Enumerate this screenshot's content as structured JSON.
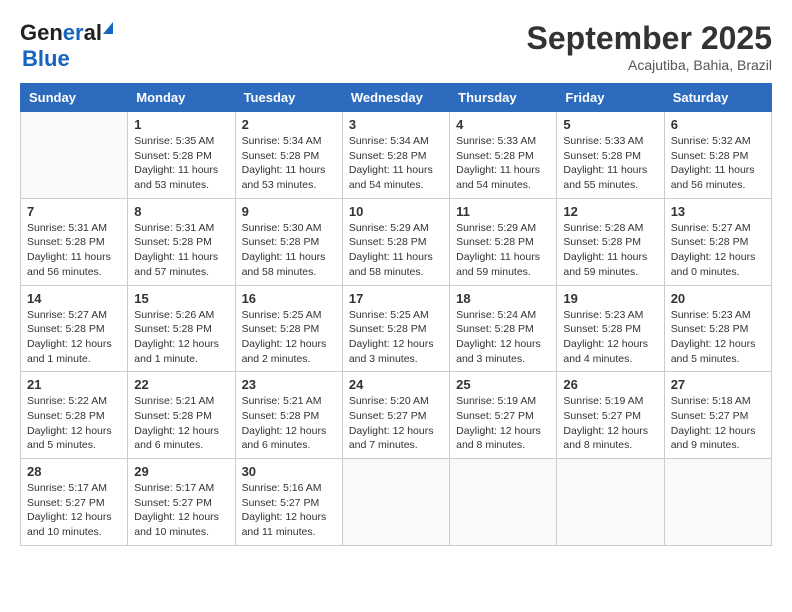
{
  "header": {
    "logo_line1": "General",
    "logo_line2": "Blue",
    "month": "September 2025",
    "location": "Acajutiba, Bahia, Brazil"
  },
  "weekdays": [
    "Sunday",
    "Monday",
    "Tuesday",
    "Wednesday",
    "Thursday",
    "Friday",
    "Saturday"
  ],
  "weeks": [
    [
      {
        "day": "",
        "sunrise": "",
        "sunset": "",
        "daylight": ""
      },
      {
        "day": "1",
        "sunrise": "Sunrise: 5:35 AM",
        "sunset": "Sunset: 5:28 PM",
        "daylight": "Daylight: 11 hours and 53 minutes."
      },
      {
        "day": "2",
        "sunrise": "Sunrise: 5:34 AM",
        "sunset": "Sunset: 5:28 PM",
        "daylight": "Daylight: 11 hours and 53 minutes."
      },
      {
        "day": "3",
        "sunrise": "Sunrise: 5:34 AM",
        "sunset": "Sunset: 5:28 PM",
        "daylight": "Daylight: 11 hours and 54 minutes."
      },
      {
        "day": "4",
        "sunrise": "Sunrise: 5:33 AM",
        "sunset": "Sunset: 5:28 PM",
        "daylight": "Daylight: 11 hours and 54 minutes."
      },
      {
        "day": "5",
        "sunrise": "Sunrise: 5:33 AM",
        "sunset": "Sunset: 5:28 PM",
        "daylight": "Daylight: 11 hours and 55 minutes."
      },
      {
        "day": "6",
        "sunrise": "Sunrise: 5:32 AM",
        "sunset": "Sunset: 5:28 PM",
        "daylight": "Daylight: 11 hours and 56 minutes."
      }
    ],
    [
      {
        "day": "7",
        "sunrise": "Sunrise: 5:31 AM",
        "sunset": "Sunset: 5:28 PM",
        "daylight": "Daylight: 11 hours and 56 minutes."
      },
      {
        "day": "8",
        "sunrise": "Sunrise: 5:31 AM",
        "sunset": "Sunset: 5:28 PM",
        "daylight": "Daylight: 11 hours and 57 minutes."
      },
      {
        "day": "9",
        "sunrise": "Sunrise: 5:30 AM",
        "sunset": "Sunset: 5:28 PM",
        "daylight": "Daylight: 11 hours and 58 minutes."
      },
      {
        "day": "10",
        "sunrise": "Sunrise: 5:29 AM",
        "sunset": "Sunset: 5:28 PM",
        "daylight": "Daylight: 11 hours and 58 minutes."
      },
      {
        "day": "11",
        "sunrise": "Sunrise: 5:29 AM",
        "sunset": "Sunset: 5:28 PM",
        "daylight": "Daylight: 11 hours and 59 minutes."
      },
      {
        "day": "12",
        "sunrise": "Sunrise: 5:28 AM",
        "sunset": "Sunset: 5:28 PM",
        "daylight": "Daylight: 11 hours and 59 minutes."
      },
      {
        "day": "13",
        "sunrise": "Sunrise: 5:27 AM",
        "sunset": "Sunset: 5:28 PM",
        "daylight": "Daylight: 12 hours and 0 minutes."
      }
    ],
    [
      {
        "day": "14",
        "sunrise": "Sunrise: 5:27 AM",
        "sunset": "Sunset: 5:28 PM",
        "daylight": "Daylight: 12 hours and 1 minute."
      },
      {
        "day": "15",
        "sunrise": "Sunrise: 5:26 AM",
        "sunset": "Sunset: 5:28 PM",
        "daylight": "Daylight: 12 hours and 1 minute."
      },
      {
        "day": "16",
        "sunrise": "Sunrise: 5:25 AM",
        "sunset": "Sunset: 5:28 PM",
        "daylight": "Daylight: 12 hours and 2 minutes."
      },
      {
        "day": "17",
        "sunrise": "Sunrise: 5:25 AM",
        "sunset": "Sunset: 5:28 PM",
        "daylight": "Daylight: 12 hours and 3 minutes."
      },
      {
        "day": "18",
        "sunrise": "Sunrise: 5:24 AM",
        "sunset": "Sunset: 5:28 PM",
        "daylight": "Daylight: 12 hours and 3 minutes."
      },
      {
        "day": "19",
        "sunrise": "Sunrise: 5:23 AM",
        "sunset": "Sunset: 5:28 PM",
        "daylight": "Daylight: 12 hours and 4 minutes."
      },
      {
        "day": "20",
        "sunrise": "Sunrise: 5:23 AM",
        "sunset": "Sunset: 5:28 PM",
        "daylight": "Daylight: 12 hours and 5 minutes."
      }
    ],
    [
      {
        "day": "21",
        "sunrise": "Sunrise: 5:22 AM",
        "sunset": "Sunset: 5:28 PM",
        "daylight": "Daylight: 12 hours and 5 minutes."
      },
      {
        "day": "22",
        "sunrise": "Sunrise: 5:21 AM",
        "sunset": "Sunset: 5:28 PM",
        "daylight": "Daylight: 12 hours and 6 minutes."
      },
      {
        "day": "23",
        "sunrise": "Sunrise: 5:21 AM",
        "sunset": "Sunset: 5:28 PM",
        "daylight": "Daylight: 12 hours and 6 minutes."
      },
      {
        "day": "24",
        "sunrise": "Sunrise: 5:20 AM",
        "sunset": "Sunset: 5:27 PM",
        "daylight": "Daylight: 12 hours and 7 minutes."
      },
      {
        "day": "25",
        "sunrise": "Sunrise: 5:19 AM",
        "sunset": "Sunset: 5:27 PM",
        "daylight": "Daylight: 12 hours and 8 minutes."
      },
      {
        "day": "26",
        "sunrise": "Sunrise: 5:19 AM",
        "sunset": "Sunset: 5:27 PM",
        "daylight": "Daylight: 12 hours and 8 minutes."
      },
      {
        "day": "27",
        "sunrise": "Sunrise: 5:18 AM",
        "sunset": "Sunset: 5:27 PM",
        "daylight": "Daylight: 12 hours and 9 minutes."
      }
    ],
    [
      {
        "day": "28",
        "sunrise": "Sunrise: 5:17 AM",
        "sunset": "Sunset: 5:27 PM",
        "daylight": "Daylight: 12 hours and 10 minutes."
      },
      {
        "day": "29",
        "sunrise": "Sunrise: 5:17 AM",
        "sunset": "Sunset: 5:27 PM",
        "daylight": "Daylight: 12 hours and 10 minutes."
      },
      {
        "day": "30",
        "sunrise": "Sunrise: 5:16 AM",
        "sunset": "Sunset: 5:27 PM",
        "daylight": "Daylight: 12 hours and 11 minutes."
      },
      {
        "day": "",
        "sunrise": "",
        "sunset": "",
        "daylight": ""
      },
      {
        "day": "",
        "sunrise": "",
        "sunset": "",
        "daylight": ""
      },
      {
        "day": "",
        "sunrise": "",
        "sunset": "",
        "daylight": ""
      },
      {
        "day": "",
        "sunrise": "",
        "sunset": "",
        "daylight": ""
      }
    ]
  ]
}
